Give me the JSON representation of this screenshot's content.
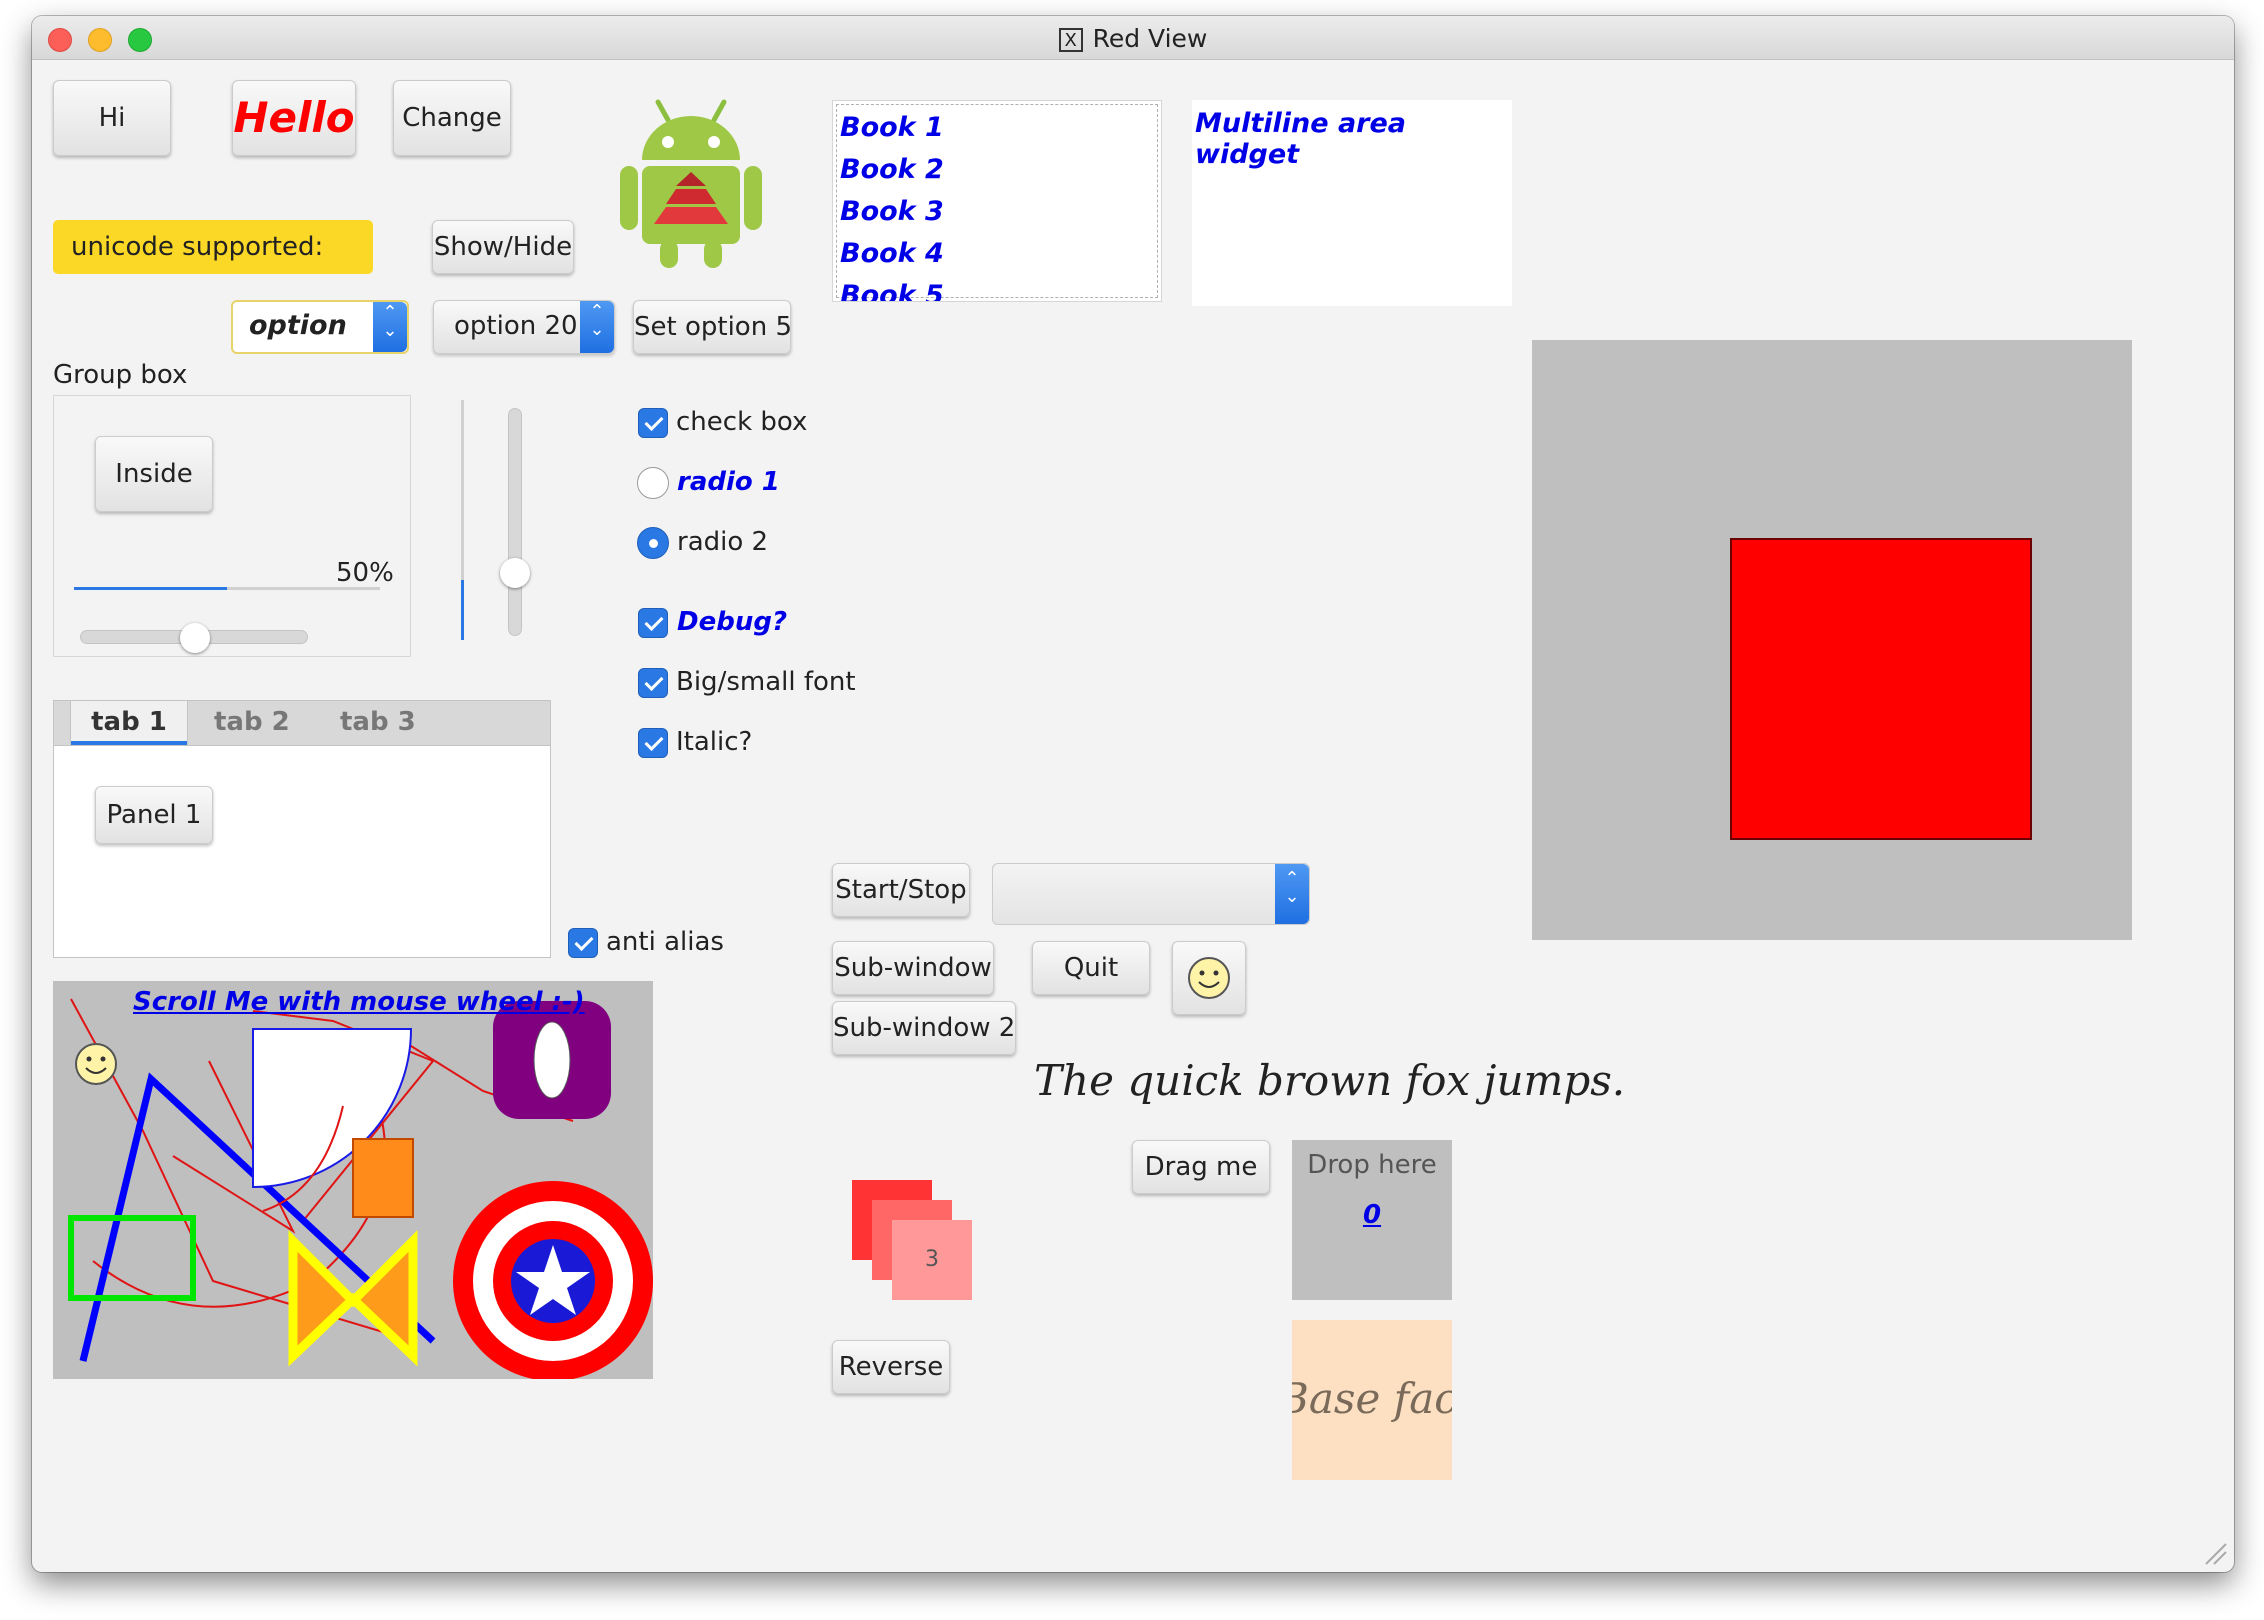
{
  "window": {
    "title": "Red View"
  },
  "buttons": {
    "hi": "Hi",
    "hello": "Hello",
    "change": "Change",
    "show_hide": "Show/Hide",
    "set_option": "Set option 5",
    "inside": "Inside",
    "panel1": "Panel 1",
    "start_stop": "Start/Stop",
    "sub_window": "Sub-window",
    "quit": "Quit",
    "sub_window2": "Sub-window 2",
    "drag_me": "Drag me",
    "reverse": "Reverse"
  },
  "unicode_label": "unicode supported:",
  "selects": {
    "option_a": "option",
    "option_b": "option 20"
  },
  "list": {
    "items": [
      "Book 1",
      "Book 2",
      "Book 3",
      "Book 4",
      "Book 5"
    ]
  },
  "multiline": {
    "text": "Multiline area widget"
  },
  "group_box": {
    "title": "Group box",
    "progress_text": "50%",
    "progress": 0.5,
    "slider": 0.5
  },
  "vslider": {
    "progress": 0.25,
    "slider": 0.75
  },
  "checks": {
    "check_box": "check box",
    "radio1": "radio 1",
    "radio2": "radio 2",
    "debug": "Debug?",
    "big_small": "Big/small font",
    "italic": "Italic?",
    "anti_alias": "anti alias"
  },
  "tabs": [
    "tab 1",
    "tab 2",
    "tab 3"
  ],
  "canvas": {
    "caption": "Scroll Me with mouse wheel :-)"
  },
  "fox_text": "The quick brown fox jumps.",
  "drop": {
    "label": "Drop here",
    "count": "0"
  },
  "stack_number": "3",
  "base_face": "Base face",
  "colors": {
    "red": "#ff0000",
    "blue": "#0000e6",
    "yellow_label": "#fcd826",
    "gray_panel": "#bfbfbf"
  }
}
